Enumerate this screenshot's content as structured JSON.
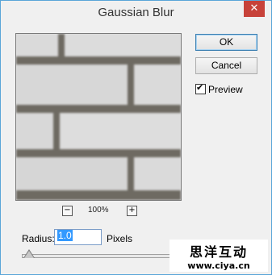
{
  "window": {
    "title": "Gaussian Blur",
    "close_glyph": "✕"
  },
  "buttons": {
    "ok_label": "OK",
    "cancel_label": "Cancel"
  },
  "preview": {
    "checkbox_label": "Preview",
    "checked": true,
    "check_glyph": "✔"
  },
  "zoom": {
    "level": "100%",
    "zoom_out_glyph": "−",
    "zoom_in_glyph": "+"
  },
  "radius": {
    "label": "Radius:",
    "value": "1.0",
    "unit": "Pixels",
    "slider_fraction": 0.01
  },
  "watermark": {
    "line1": "思洋互动",
    "line2": "www.ciya.cn"
  },
  "colors": {
    "accent": "#5aa5d8",
    "close": "#c7423a",
    "selection": "#3399ff"
  }
}
